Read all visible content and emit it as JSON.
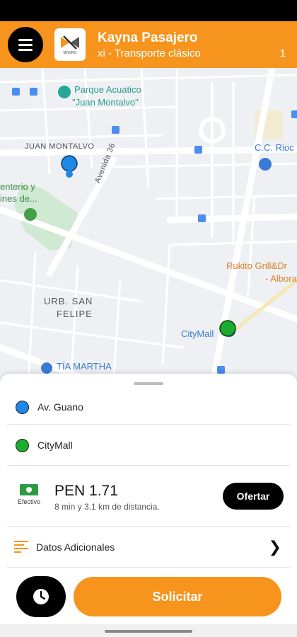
{
  "header": {
    "title": "Kayna Pasajero",
    "subtitle": "xi - Transporte clásico",
    "count": "1",
    "logo_text": "MOVRO"
  },
  "map": {
    "labels": {
      "parque_line1": "Parque Acuatico",
      "parque_line2": "\"Juan Montalvo\"",
      "juan_montalvo": "JUAN MONTALVO",
      "avenida": "Avenida 36",
      "cc_rioc": "C.C. Rioc",
      "entierro_line1": "enterio y",
      "entierro_line2": "ines de...",
      "rukito_line1": "Rukito Grill&Dr",
      "rukito_line2": "- Albora",
      "urb_line1": "URB. SAN",
      "urb_line2": "FELIPE",
      "citymall": "CityMall",
      "tia_martha": "TÍA MARTHA"
    }
  },
  "trip": {
    "origin": "Av. Guano",
    "destination": "CityMall",
    "payment_label": "Efectivo",
    "price": "PEN 1.71",
    "info": "8 min y 3.1 km de distancia.",
    "offer_label": "Ofertar",
    "extra_label": "Datos Adicionales",
    "request_label": "Solicitar"
  },
  "colors": {
    "accent": "#f7941d",
    "origin": "#1e88e5",
    "destination": "#1aac2c"
  }
}
